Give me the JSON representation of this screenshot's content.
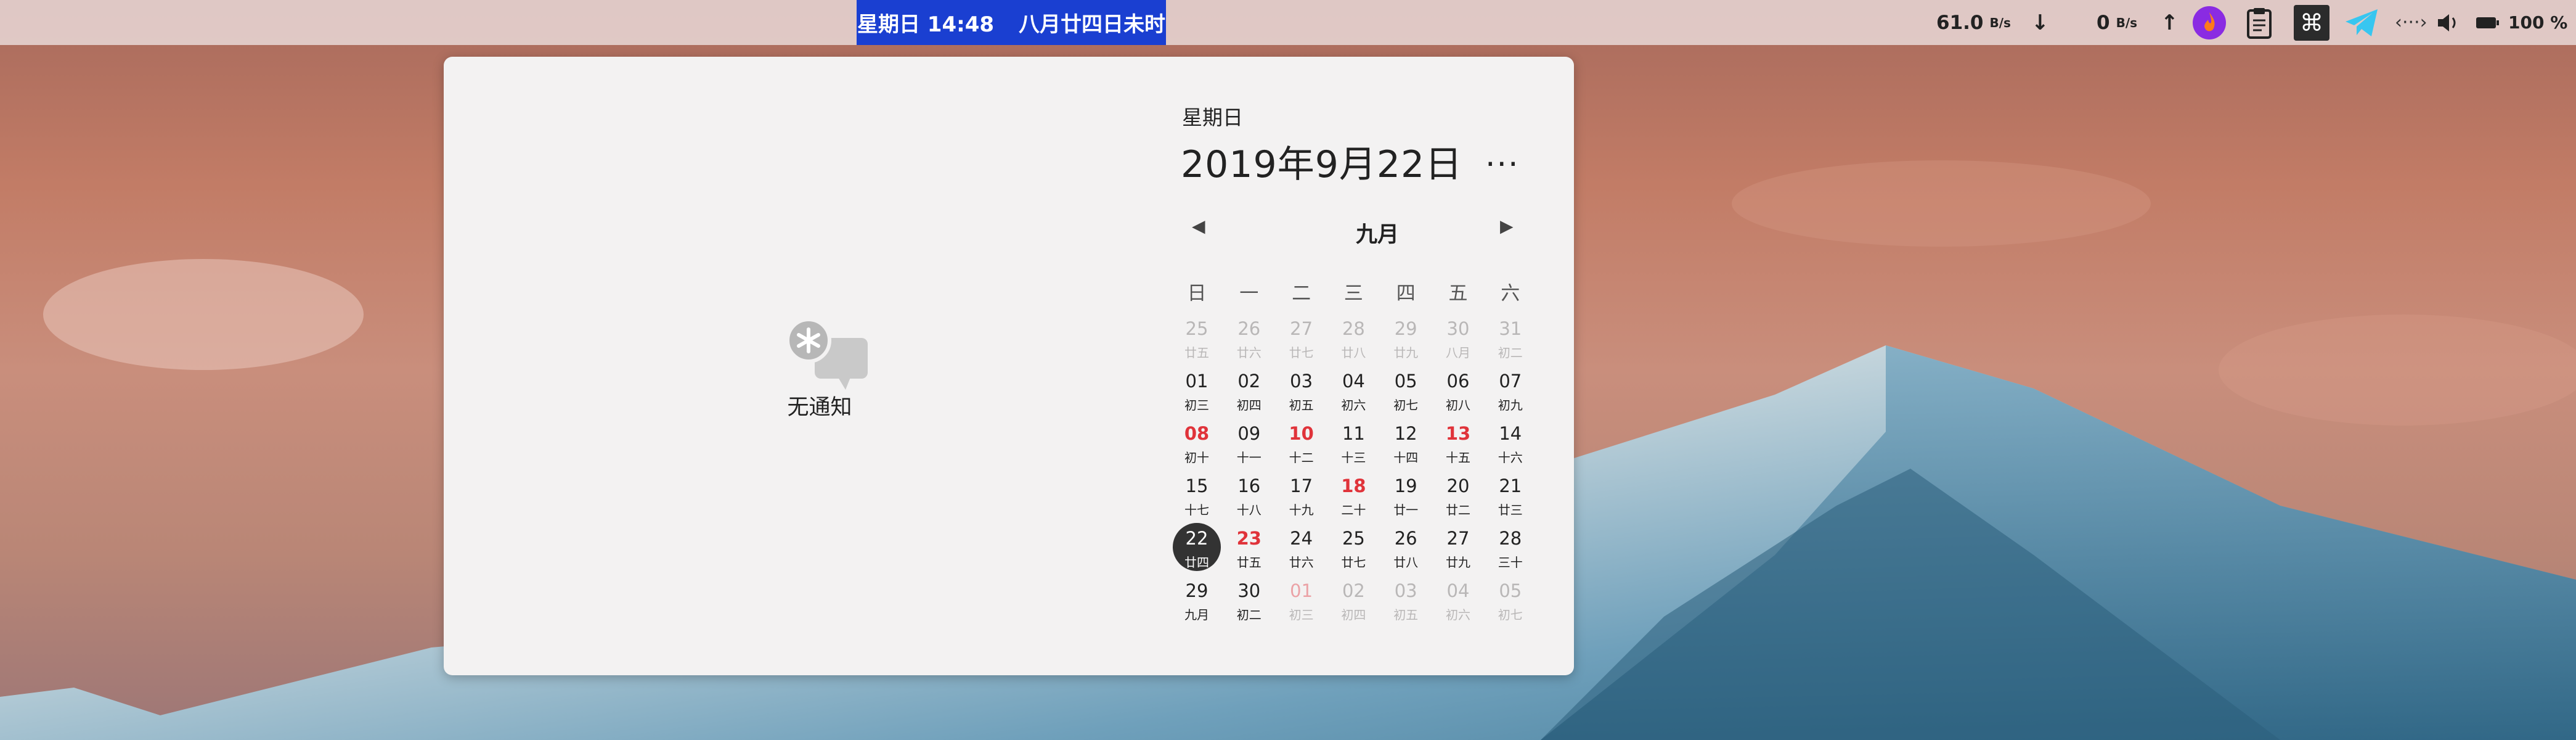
{
  "topbar": {
    "clock_day": "星期日 14:48",
    "clock_lunar": "八月廿四日未时",
    "down_speed": "61.0",
    "down_unit": "B/s",
    "up_speed": "0",
    "up_unit": "B/s",
    "battery": "100 %"
  },
  "notifications": {
    "empty_text": "无通知"
  },
  "calendar": {
    "weekday": "星期日",
    "full_date": "2019年9月22日",
    "more": "...",
    "month": "九月",
    "week_header": [
      "日",
      "一",
      "二",
      "三",
      "四",
      "五",
      "六"
    ],
    "weeks": [
      [
        {
          "n": "25",
          "l": "廿五",
          "faded": true
        },
        {
          "n": "26",
          "l": "廿六",
          "faded": true
        },
        {
          "n": "27",
          "l": "廿七",
          "faded": true
        },
        {
          "n": "28",
          "l": "廿八",
          "faded": true
        },
        {
          "n": "29",
          "l": "廿九",
          "faded": true
        },
        {
          "n": "30",
          "l": "八月",
          "faded": true
        },
        {
          "n": "31",
          "l": "初二",
          "faded": true
        }
      ],
      [
        {
          "n": "01",
          "l": "初三"
        },
        {
          "n": "02",
          "l": "初四"
        },
        {
          "n": "03",
          "l": "初五"
        },
        {
          "n": "04",
          "l": "初六"
        },
        {
          "n": "05",
          "l": "初七"
        },
        {
          "n": "06",
          "l": "初八"
        },
        {
          "n": "07",
          "l": "初九"
        }
      ],
      [
        {
          "n": "08",
          "l": "初十",
          "red": true
        },
        {
          "n": "09",
          "l": "十一"
        },
        {
          "n": "10",
          "l": "十二",
          "red": true
        },
        {
          "n": "11",
          "l": "十三"
        },
        {
          "n": "12",
          "l": "十四"
        },
        {
          "n": "13",
          "l": "十五",
          "red": true
        },
        {
          "n": "14",
          "l": "十六"
        }
      ],
      [
        {
          "n": "15",
          "l": "十七"
        },
        {
          "n": "16",
          "l": "十八"
        },
        {
          "n": "17",
          "l": "十九"
        },
        {
          "n": "18",
          "l": "二十",
          "red": true
        },
        {
          "n": "19",
          "l": "廿一"
        },
        {
          "n": "20",
          "l": "廿二"
        },
        {
          "n": "21",
          "l": "廿三"
        }
      ],
      [
        {
          "n": "22",
          "l": "廿四",
          "today": true
        },
        {
          "n": "23",
          "l": "廿五",
          "red": true
        },
        {
          "n": "24",
          "l": "廿六"
        },
        {
          "n": "25",
          "l": "廿七"
        },
        {
          "n": "26",
          "l": "廿八"
        },
        {
          "n": "27",
          "l": "廿九"
        },
        {
          "n": "28",
          "l": "三十"
        }
      ],
      [
        {
          "n": "29",
          "l": "九月"
        },
        {
          "n": "30",
          "l": "初二"
        },
        {
          "n": "01",
          "l": "初三",
          "faded": true,
          "red": true
        },
        {
          "n": "02",
          "l": "初四",
          "faded": true
        },
        {
          "n": "03",
          "l": "初五",
          "faded": true
        },
        {
          "n": "04",
          "l": "初六",
          "faded": true
        },
        {
          "n": "05",
          "l": "初七",
          "faded": true
        }
      ]
    ]
  },
  "colors": {
    "clock_bg": "#1a3fd1",
    "holiday_red": "#e0333a",
    "today_circle": "#333333"
  }
}
